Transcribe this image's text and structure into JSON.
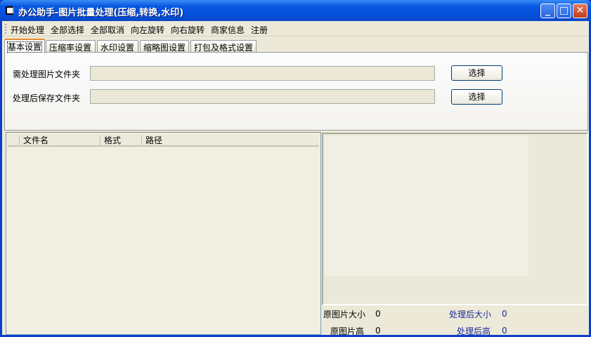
{
  "window": {
    "title": "办公助手-图片批量处理(压缩,转换,水印)",
    "minimize": "_",
    "maximize": "□",
    "close": "✕"
  },
  "menu": [
    "开始处理",
    "全部选择",
    "全部取消",
    "向左旋转",
    "向右旋转",
    "商家信息",
    "注册"
  ],
  "tabs": [
    "基本设置",
    "压缩率设置",
    "水印设置",
    "缩略图设置",
    "打包及格式设置"
  ],
  "basic": {
    "source_label": "需处理图片文件夹",
    "source_value": "",
    "output_label": "处理后保存文件夹",
    "output_value": "",
    "choose": "选择"
  },
  "list": {
    "columns": [
      "文件名",
      "格式",
      "路径"
    ]
  },
  "info": {
    "orig_size_label": "原图片大小",
    "orig_size": "0",
    "new_size_label": "处理后大小",
    "new_size": "0",
    "orig_h_label": "原图片高",
    "orig_h": "0",
    "new_h_label": "处理后高",
    "new_h": "0"
  }
}
